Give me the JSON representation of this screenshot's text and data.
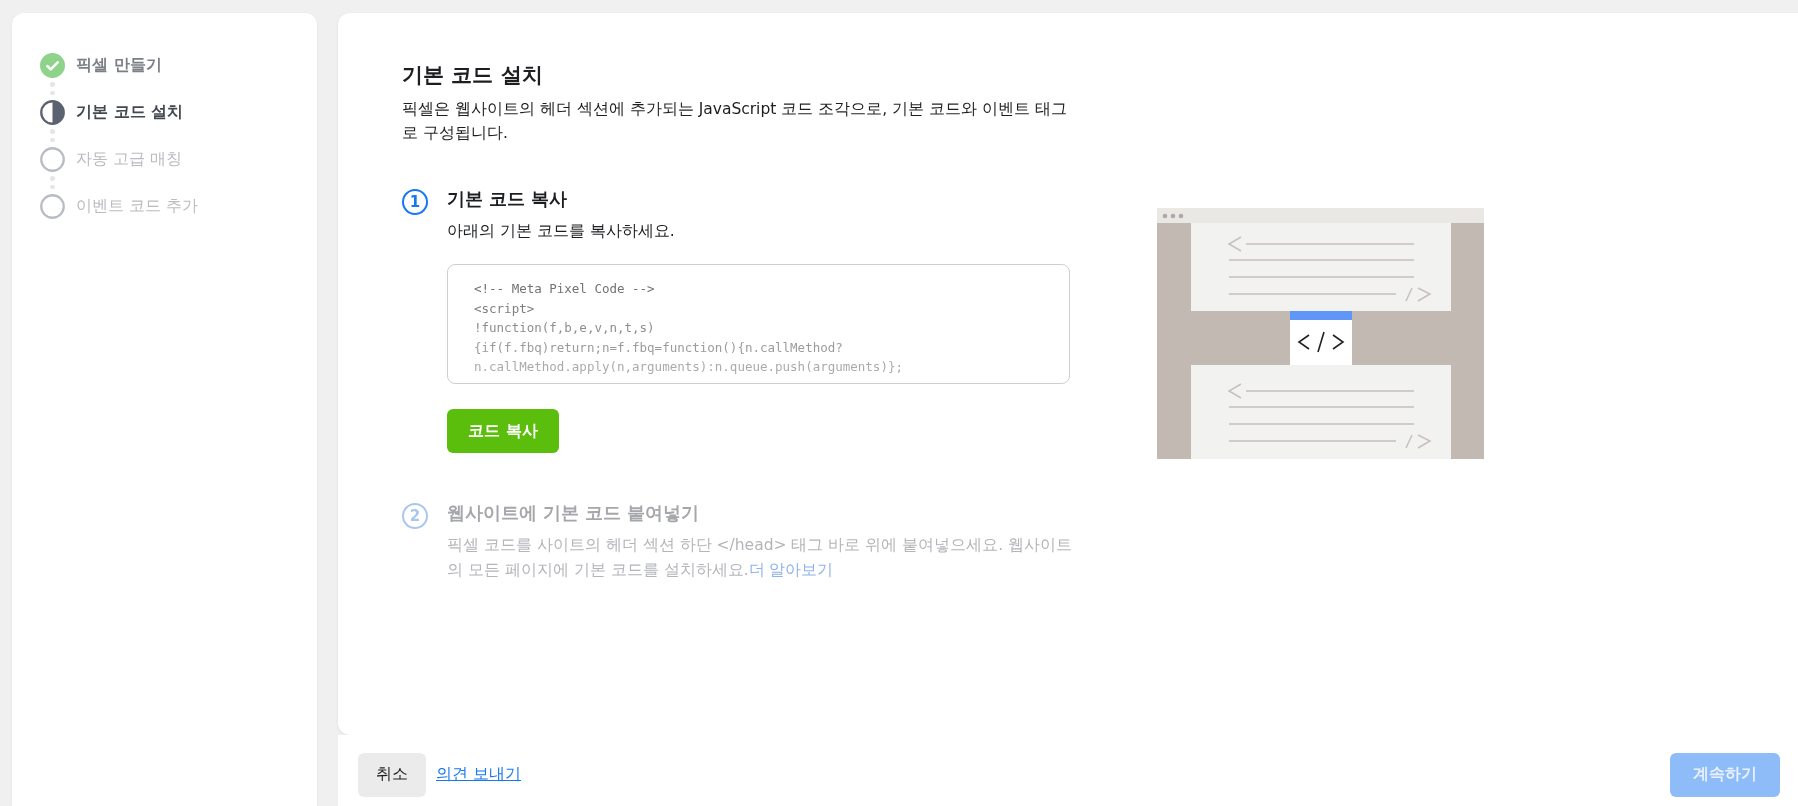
{
  "sidebar": {
    "steps": [
      {
        "label": "픽셀 만들기",
        "completed": true,
        "current": false
      },
      {
        "label": "기본 코드 설치",
        "completed": false,
        "current": true
      },
      {
        "label": "자동 고급 매칭",
        "completed": false,
        "current": false
      },
      {
        "label": "이벤트 코드 추가",
        "completed": false,
        "current": false
      }
    ]
  },
  "main": {
    "title": "기본 코드 설치",
    "description": "픽셀은 웹사이트의 헤더 섹션에 추가되는 JavaScript 코드 조각으로, 기본 코드와 이벤트 태그로 구성됩니다.",
    "steps": [
      {
        "number": "1",
        "title": "기본 코드 복사",
        "text": "아래의 기본 코드를 복사하세요.",
        "disabled": false,
        "code": [
          "<!-- Meta Pixel Code -->",
          "<script>",
          "!function(f,b,e,v,n,t,s)",
          "{if(f.fbq)return;n=f.fbq=function(){n.callMethod?",
          "n.callMethod.apply(n,arguments):n.queue.push(arguments)};"
        ],
        "button": "코드 복사"
      },
      {
        "number": "2",
        "title": "웹사이트에 기본 코드 붙여넣기",
        "text": "픽셀 코드를 사이트의 헤더 섹션 하단 </head> 태그 바로 위에 붙여넣으세요. 웹사이트의 모든 페이지에 기본 코드를 설치하세요.",
        "link": "더 알아보기",
        "disabled": true
      }
    ]
  },
  "footer": {
    "cancel": "취소",
    "feedback": "의견 보내기",
    "continue": {
      "label": "계속하기",
      "disabled": true
    }
  }
}
